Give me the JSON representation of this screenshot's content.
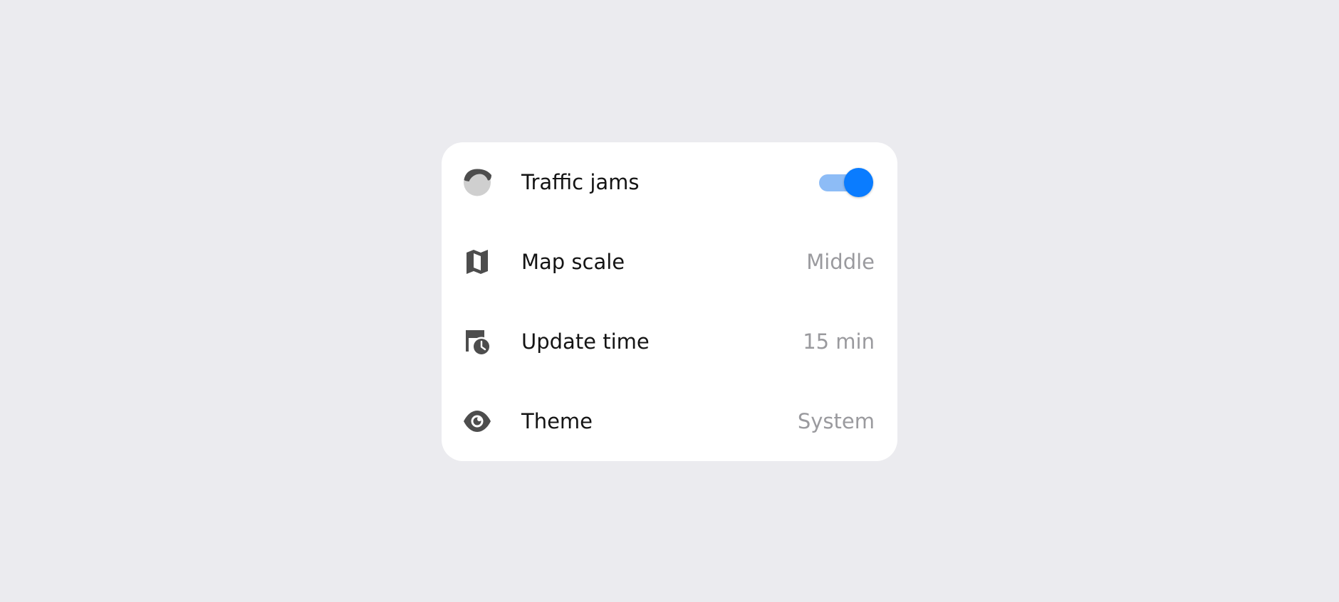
{
  "settings": {
    "rows": [
      {
        "label": "Traffic jams",
        "icon": "traffic-icon",
        "control": "toggle",
        "enabled": true
      },
      {
        "label": "Map scale",
        "icon": "map-icon",
        "value": "Middle"
      },
      {
        "label": "Update time",
        "icon": "clock-icon",
        "value": "15 min"
      },
      {
        "label": "Theme",
        "icon": "eye-icon",
        "value": "System"
      }
    ]
  },
  "colors": {
    "background": "#ebebef",
    "card": "#ffffff",
    "icon": "#4d4d4d",
    "toggle_track": "#8dbcf6",
    "toggle_knob": "#0a7cff",
    "value_text": "#9a9a9e"
  }
}
